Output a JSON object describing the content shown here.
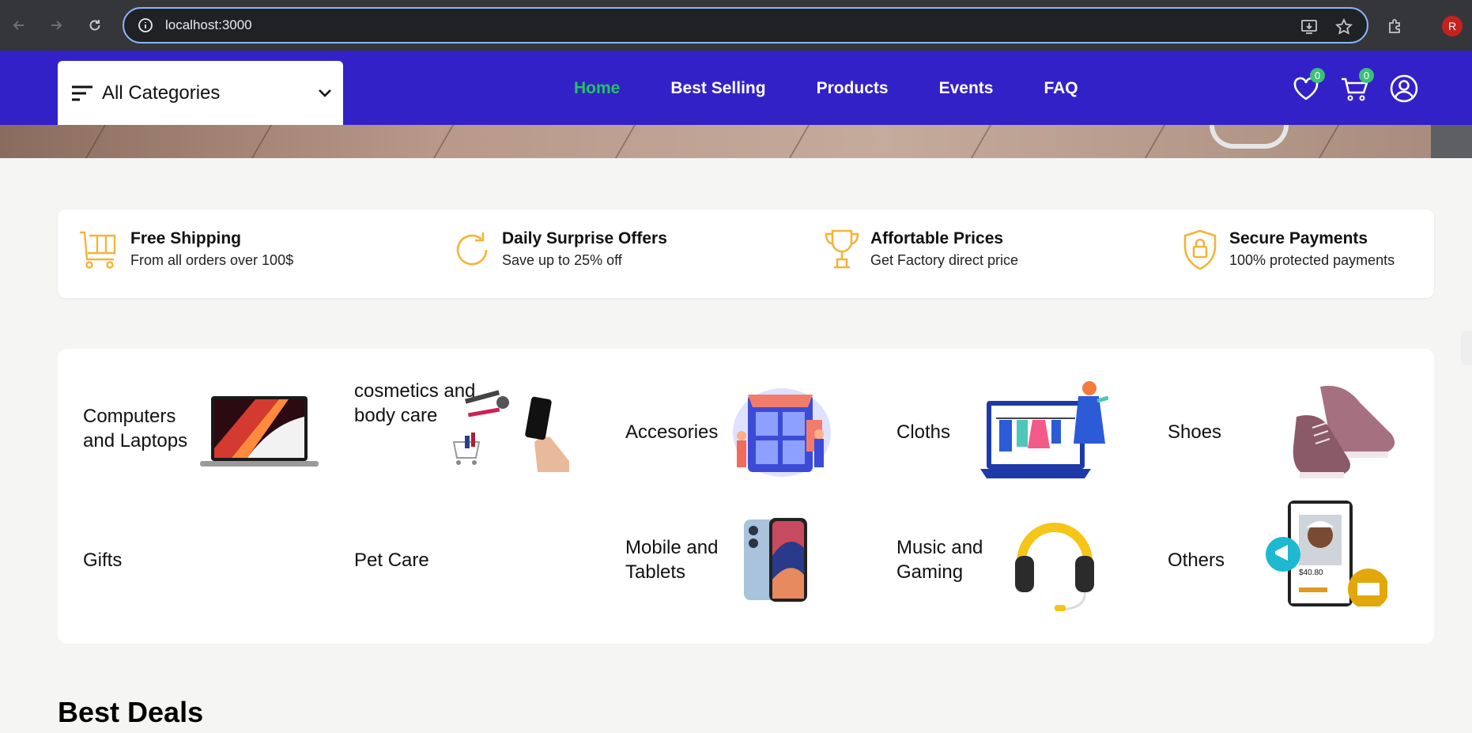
{
  "browser": {
    "url": "localhost:3000",
    "profile_initial": "R"
  },
  "header": {
    "category_dropdown_label": "All Categories",
    "nav": [
      {
        "label": "Home",
        "active": true
      },
      {
        "label": "Best Selling",
        "active": false
      },
      {
        "label": "Products",
        "active": false
      },
      {
        "label": "Events",
        "active": false
      },
      {
        "label": "FAQ",
        "active": false
      }
    ],
    "wishlist_count": "0",
    "cart_count": "0",
    "colors": {
      "bar": "#3321c8",
      "active": "#22c55e"
    }
  },
  "features": [
    {
      "icon": "cart-icon",
      "title": "Free Shipping",
      "subtitle": "From all orders over 100$"
    },
    {
      "icon": "refresh-icon",
      "title": "Daily Surprise Offers",
      "subtitle": "Save up to 25% off"
    },
    {
      "icon": "trophy-icon",
      "title": "Affortable Prices",
      "subtitle": "Get Factory direct price"
    },
    {
      "icon": "shield-lock-icon",
      "title": "Secure Payments",
      "subtitle": "100% protected payments"
    }
  ],
  "categories": [
    {
      "name": "Computers and Laptops",
      "image": "laptop-image"
    },
    {
      "name": "cosmetics and body care",
      "image": "cosmetics-image"
    },
    {
      "name": "Accesories",
      "image": "accessories-shop-image"
    },
    {
      "name": "Cloths",
      "image": "clothes-laptop-image"
    },
    {
      "name": "Shoes",
      "image": "shoes-image"
    },
    {
      "name": "Gifts",
      "image": ""
    },
    {
      "name": "Pet Care",
      "image": ""
    },
    {
      "name": "Mobile and Tablets",
      "image": "iphone-image"
    },
    {
      "name": "Music and Gaming",
      "image": "headphones-image"
    },
    {
      "name": "Others",
      "image": "phone-shop-image"
    }
  ],
  "others_price": "$40.80",
  "section_title": "Best Deals"
}
